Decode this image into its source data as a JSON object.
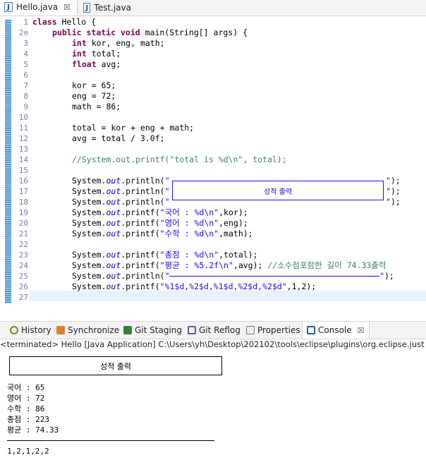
{
  "tabs": [
    {
      "label": "Hello.java",
      "active": true,
      "icon": "java-file-icon"
    },
    {
      "label": "Test.java",
      "active": false,
      "icon": "java-file-icon"
    }
  ],
  "editor": {
    "line_numbers": [
      "1",
      "2⊖",
      "3",
      "4",
      "5",
      "6",
      "7",
      "8",
      "9",
      "10",
      "11",
      "12",
      "13",
      "14",
      "15",
      "16",
      "17",
      "18",
      "19",
      "20",
      "21",
      "22",
      "23",
      "24",
      "25",
      "26",
      "27"
    ],
    "code": {
      "l1a": "class",
      "l1b": " Hello {",
      "l2a": "public",
      "l2b": " ",
      "l2c": "static",
      "l2d": " ",
      "l2e": "void",
      "l2f": " main(String[] args) {",
      "l3a": "int",
      "l3b": " kor, eng, math;",
      "l4a": "int",
      "l4b": " total;",
      "l5a": "float",
      "l5b": " avg;",
      "l7": "kor = 65;",
      "l8": "eng = 72;",
      "l9": "math = 86;",
      "l11": "total = kor + eng + math;",
      "l12": "avg = total / 3.0f;",
      "l14": "//System.out.printf(\"total is %d\\n\", total);",
      "sys": "System.",
      "out": "out",
      "println": ".println(",
      "printf": ".printf(",
      "q": "\"",
      "l16end": "\");",
      "l16box": "\"┌──────────────────────────────────────────┐\");",
      "l17box": "\"│                 성적  출력                │\");",
      "l18box": "\"└──────────────────────────────────────────┘\");",
      "l19s": "\"국어 : %d\\n\"",
      "l19e": ",kor);",
      "l20s": "\"영어 : %d\\n\"",
      "l20e": ",eng);",
      "l21s": "\"수학 : %d\\n\"",
      "l21e": ",math);",
      "l23s": "\"총점 : %d\\n\"",
      "l23e": ",total);",
      "l24s": "\"평균 : %5.2f\\n\"",
      "l24e": ",avg); ",
      "l24c": "//소수점포함한 길이 74.33출력",
      "l25s": "\"────────────────────────────────────────\"",
      "l25e": ");",
      "l26s": "\"%1$d,%2$d,%1$d,%2$d,%2$d\"",
      "l26e": ",1,2);"
    },
    "scroll_left": "<"
  },
  "views": [
    {
      "label": "History",
      "icon": "history-icon",
      "color": "#6b8e23"
    },
    {
      "label": "Synchronize",
      "icon": "synchronize-icon",
      "color": "#d9822b"
    },
    {
      "label": "Git Staging",
      "icon": "git-staging-icon",
      "color": "#3a7d3a"
    },
    {
      "label": "Git Reflog",
      "icon": "git-reflog-icon",
      "color": "#5a5a9a"
    },
    {
      "label": "Properties",
      "icon": "properties-icon",
      "color": "#777777"
    },
    {
      "label": "Console",
      "icon": "console-icon",
      "color": "#2f5d8a",
      "active": true
    }
  ],
  "console": {
    "header": "<terminated> Hello [Java Application] C:\\Users\\yh\\Desktop\\202102\\tools\\eclipse\\plugins\\org.eclipse.just",
    "title": "성적  출력",
    "lines": [
      "국어 : 65",
      "영어 : 72",
      "수학 : 86",
      "총점 : 223",
      "평균 : 74.33"
    ],
    "last": "1,2,1,2,2"
  }
}
